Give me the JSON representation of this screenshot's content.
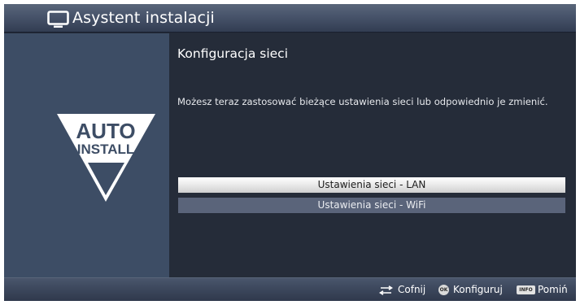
{
  "header": {
    "title": "Asystent instalacji",
    "icon": "tv-icon"
  },
  "logo": {
    "line1": "AUTO",
    "line2": "INSTALL",
    "icon": "auto-install-logo"
  },
  "main": {
    "title": "Konfiguracja sieci",
    "description": "Możesz teraz zastosować bieżące ustawienia sieci lub odpowiednio je zmienić.",
    "options": [
      {
        "label": "Ustawienia sieci - LAN",
        "selected": true
      },
      {
        "label": "Ustawienia sieci - WiFi",
        "selected": false
      }
    ]
  },
  "footer": {
    "back_label": "Cofnij",
    "ok_badge": "OK",
    "ok_label": "Konfiguruj",
    "info_badge": "INFO",
    "info_label": "Pomiń"
  },
  "colors": {
    "header": "#47536a",
    "left_panel": "#3d4d65",
    "content_bg": "#252c39",
    "selected_option": "#e9e9e9",
    "unselected_option": "#5a647a"
  }
}
